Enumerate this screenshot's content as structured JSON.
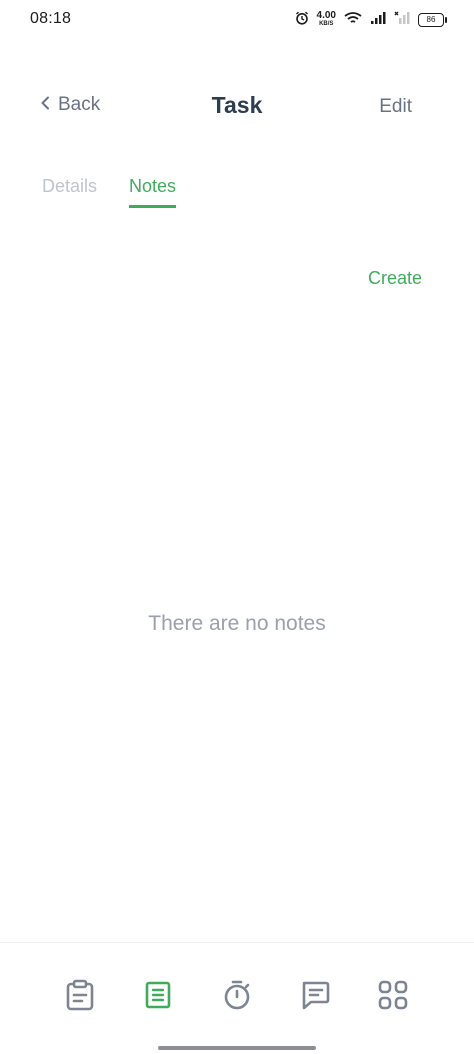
{
  "status_bar": {
    "time": "08:18",
    "net_speed_value": "4.00",
    "net_speed_unit": "KB/S",
    "battery": "86",
    "icons": [
      "alarm-icon",
      "wifi-icon",
      "signal-icon",
      "signal-off-icon",
      "battery-icon"
    ]
  },
  "header": {
    "back_label": "Back",
    "title": "Task",
    "edit_label": "Edit"
  },
  "tabs": [
    {
      "label": "Details",
      "active": false
    },
    {
      "label": "Notes",
      "active": true
    }
  ],
  "notes": {
    "create_label": "Create",
    "empty_message": "There are no notes"
  },
  "bottom_nav": {
    "items": [
      {
        "icon": "clipboard-icon",
        "active": false
      },
      {
        "icon": "notes-icon",
        "active": true
      },
      {
        "icon": "timer-icon",
        "active": false
      },
      {
        "icon": "chat-icon",
        "active": false
      },
      {
        "icon": "grid-icon",
        "active": false
      }
    ]
  },
  "colors": {
    "accent": "#3fac5c",
    "inactive_icon": "#7d8594",
    "title": "#2c3e50"
  }
}
